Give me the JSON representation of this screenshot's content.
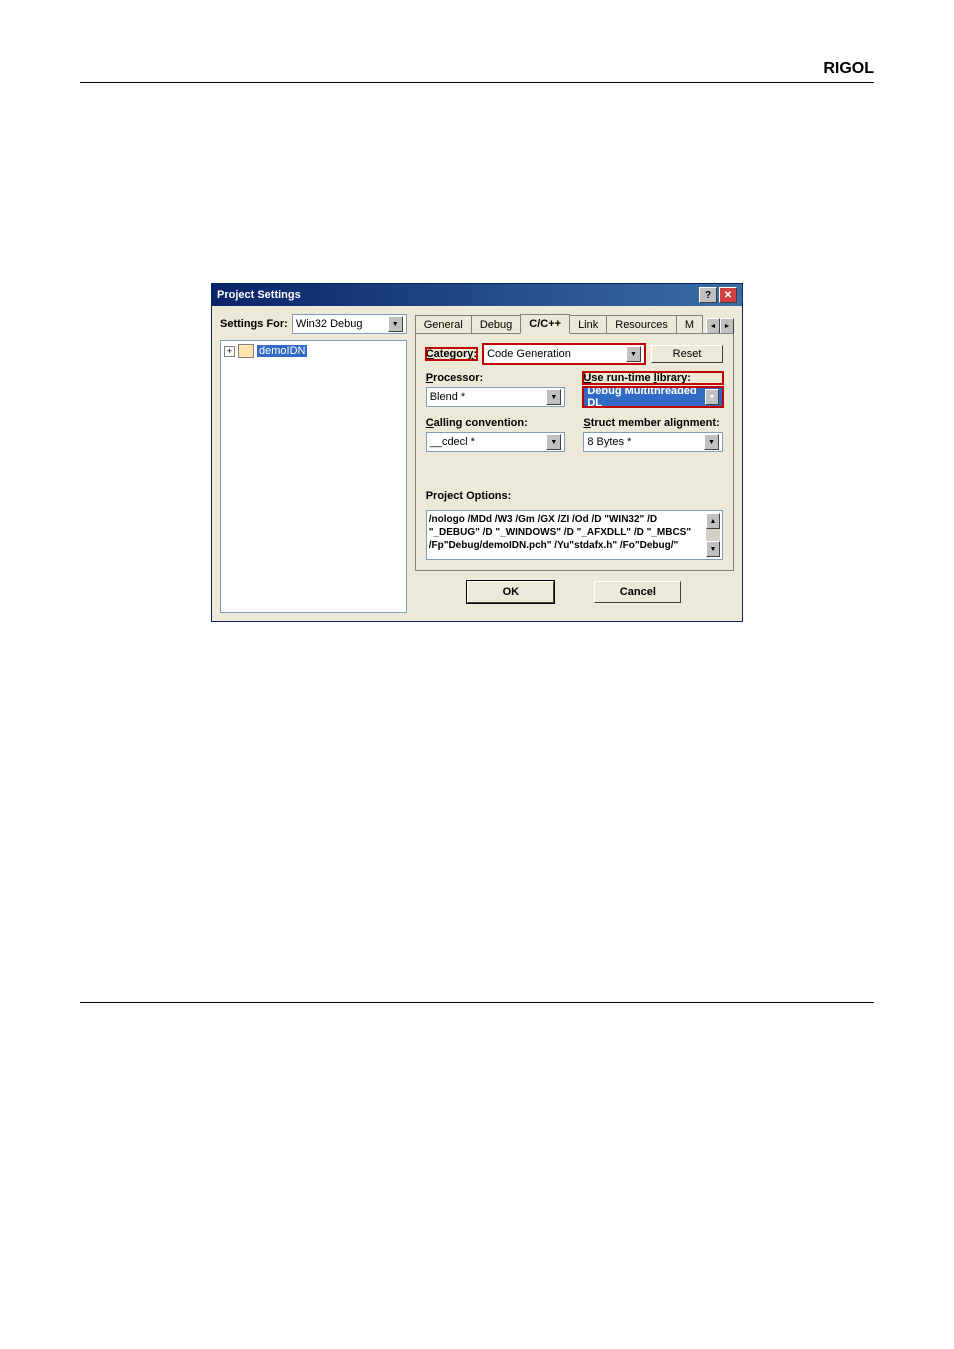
{
  "brand": "RIGOL",
  "dialog": {
    "title": "Project Settings",
    "settings_for_label": "Settings For:",
    "settings_for_value": "Win32 Debug",
    "tree_item": "demoIDN",
    "tabs": [
      "General",
      "Debug",
      "C/C++",
      "Link",
      "Resources",
      "M"
    ],
    "active_tab": "C/C++",
    "category_label": "Category:",
    "category_value": "Code Generation",
    "reset_label": "Reset",
    "fields": {
      "processor_label": "Processor:",
      "processor_value": "Blend *",
      "runtime_label": "Use run-time library:",
      "runtime_value": "Debug Multithreaded DL",
      "calling_label": "Calling convention:",
      "calling_value": "__cdecl *",
      "align_label": "Struct member alignment:",
      "align_value": "8 Bytes *"
    },
    "project_options_label": "Project Options:",
    "project_options_text": "/nologo /MDd /W3 /Gm /GX /ZI /Od /D \"WIN32\" /D \"_DEBUG\" /D \"_WINDOWS\" /D \"_AFXDLL\" /D \"_MBCS\" /Fp\"Debug/demoIDN.pch\" /Yu\"stdafx.h\" /Fo\"Debug/\"",
    "ok_label": "OK",
    "cancel_label": "Cancel"
  }
}
